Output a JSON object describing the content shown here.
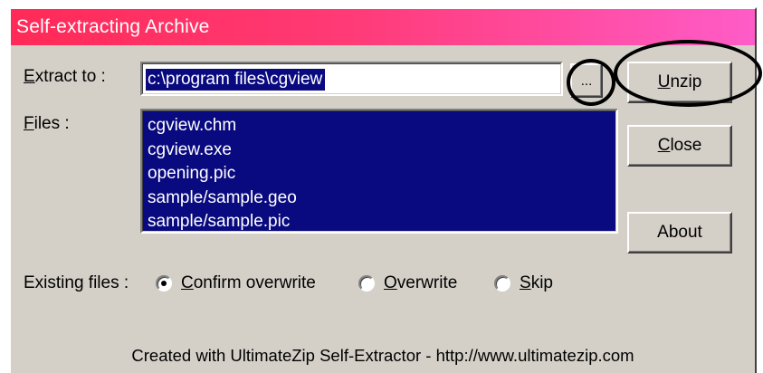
{
  "window": {
    "title": "Self-extracting Archive"
  },
  "extract": {
    "label_prefix": "E",
    "label_rest": "xtract to :",
    "path_value": "c:\\program files\\cgview"
  },
  "files": {
    "label_prefix": "F",
    "label_rest": "iles :",
    "items": [
      "cgview.chm",
      "cgview.exe",
      "opening.pic",
      "sample/sample.geo",
      "sample/sample.pic"
    ]
  },
  "buttons": {
    "browse_label": "...",
    "unzip_prefix": "U",
    "unzip_rest": "nzip",
    "close_prefix": "C",
    "close_rest": "lose",
    "about_label": "About"
  },
  "existing_files": {
    "label": "Existing files :",
    "options": [
      {
        "prefix": "C",
        "rest": "onfirm overwrite",
        "checked": true
      },
      {
        "prefix": "O",
        "rest": "verwrite",
        "checked": false
      },
      {
        "prefix": "S",
        "rest": "kip",
        "checked": false
      }
    ]
  },
  "footer": {
    "text": "Created with UltimateZip Self-Extractor - http://www.ultimatezip.com"
  },
  "colors": {
    "title_gradient_start": "#ff2a57",
    "title_gradient_end": "#ff5cc8",
    "dialog_face": "#d4d0c8",
    "selection_blue": "#0a0a80",
    "annotation": "#000000"
  }
}
